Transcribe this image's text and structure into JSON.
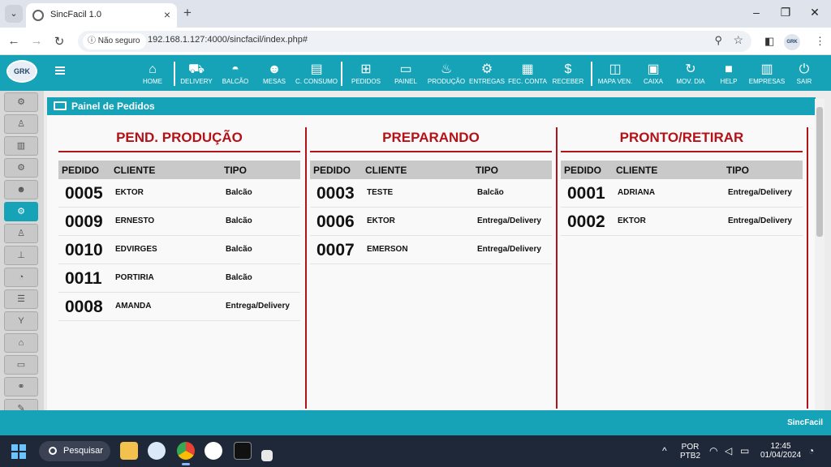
{
  "browser": {
    "tab_title": "SincFacil 1.0",
    "security_label": "Não seguro",
    "url": "192.168.1.127:4000/sincfacil/index.php#"
  },
  "app": {
    "logo_text": "GRK",
    "nav": [
      {
        "label": "HOME",
        "icon": "home-icon",
        "glyph": "⌂"
      },
      {
        "label": "DELIVERY",
        "icon": "truck-icon",
        "glyph": "⛟"
      },
      {
        "label": "BALCÃO",
        "icon": "bell-icon",
        "glyph": "◓"
      },
      {
        "label": "MESAS",
        "icon": "users-icon",
        "glyph": "☻"
      },
      {
        "label": "C. CONSUMO",
        "icon": "card-icon",
        "glyph": "▤"
      },
      {
        "label": "PEDIDOS",
        "icon": "basket-icon",
        "glyph": "⊞"
      },
      {
        "label": "PAINEL",
        "icon": "monitor-icon",
        "glyph": "▭"
      },
      {
        "label": "PRODUÇÃO",
        "icon": "chef-icon",
        "glyph": "♨"
      },
      {
        "label": "ENTREGAS",
        "icon": "motorcycle-icon",
        "glyph": "⚙"
      },
      {
        "label": "FEC. CONTA",
        "icon": "calculator-icon",
        "glyph": "▦"
      },
      {
        "label": "RECEBER",
        "icon": "money-icon",
        "glyph": "$"
      },
      {
        "label": "MAPA VEN.",
        "icon": "map-icon",
        "glyph": "◫"
      },
      {
        "label": "CAIXA",
        "icon": "cash-register-icon",
        "glyph": "▣"
      },
      {
        "label": "MOV. DIA",
        "icon": "sync-icon",
        "glyph": "↻"
      },
      {
        "label": "HELP",
        "icon": "video-icon",
        "glyph": "■"
      },
      {
        "label": "EMPRESAS",
        "icon": "building-icon",
        "glyph": "▥"
      },
      {
        "label": "SAIR",
        "icon": "power-icon",
        "glyph": "⏻"
      }
    ],
    "sidebar_icons": [
      "cogs-icon",
      "user-icon",
      "building-icon",
      "cogs-icon",
      "users-icon",
      "cogs-icon",
      "user-icon",
      "sitemap-icon",
      "rss-icon",
      "list-icon",
      "cocktail-icon",
      "bank-icon",
      "cash-icon",
      "motorcycle-icon",
      "edit-icon",
      "cogs-icon"
    ],
    "sidebar_active_index": 5,
    "panel_title": "Painel de Pedidos",
    "footer_brand": "SincFacil",
    "accent_color": "#16a3b8",
    "title_color": "#b31217"
  },
  "columns": [
    {
      "title": "PEND. PRODUÇÃO",
      "headers": [
        "PEDIDO",
        "CLIENTE",
        "TIPO"
      ],
      "rows": [
        {
          "pedido": "0005",
          "cliente": "EKTOR",
          "tipo": "Balcão"
        },
        {
          "pedido": "0009",
          "cliente": "ERNESTO",
          "tipo": "Balcão"
        },
        {
          "pedido": "0010",
          "cliente": "EDVIRGES",
          "tipo": "Balcão"
        },
        {
          "pedido": "0011",
          "cliente": "PORTIRIA",
          "tipo": "Balcão"
        },
        {
          "pedido": "0008",
          "cliente": "AMANDA",
          "tipo": "Entrega/Delivery"
        }
      ]
    },
    {
      "title": "PREPARANDO",
      "headers": [
        "PEDIDO",
        "CLIENTE",
        "TIPO"
      ],
      "rows": [
        {
          "pedido": "0003",
          "cliente": "TESTE",
          "tipo": "Balcão"
        },
        {
          "pedido": "0006",
          "cliente": "EKTOR",
          "tipo": "Entrega/Delivery"
        },
        {
          "pedido": "0007",
          "cliente": "EMERSON",
          "tipo": "Entrega/Delivery"
        }
      ]
    },
    {
      "title": "PRONTO/RETIRAR",
      "headers": [
        "PEDIDO",
        "CLIENTE",
        "TIPO"
      ],
      "rows": [
        {
          "pedido": "0001",
          "cliente": "ADRIANA",
          "tipo": "Entrega/Delivery"
        },
        {
          "pedido": "0002",
          "cliente": "EKTOR",
          "tipo": "Entrega/Delivery"
        }
      ]
    }
  ],
  "taskbar": {
    "search_label": "Pesquisar",
    "lang_top": "POR",
    "lang_bottom": "PTB2",
    "time": "12:45",
    "date": "01/04/2024"
  }
}
